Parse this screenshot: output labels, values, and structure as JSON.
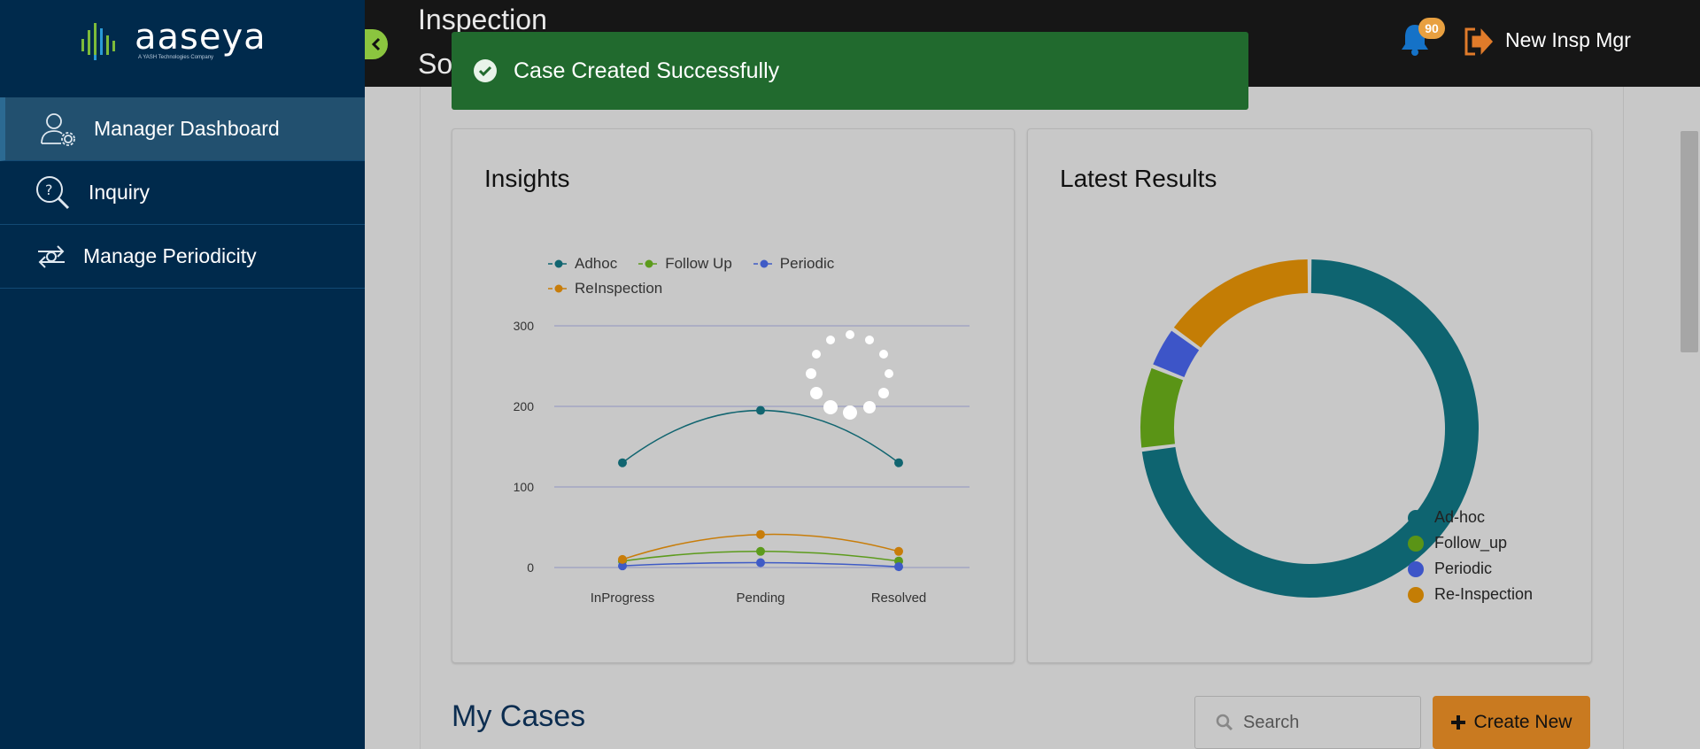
{
  "sidebar": {
    "logo_text": "aaseya",
    "logo_sub": "A YASH Technologies Company",
    "items": [
      {
        "label": "Manager Dashboard",
        "icon": "manager-user-gear-icon",
        "active": true
      },
      {
        "label": "Inquiry",
        "icon": "inquiry-search-icon",
        "active": false
      },
      {
        "label": "Manage Periodicity",
        "icon": "periodicity-refresh-icon",
        "active": false
      }
    ]
  },
  "header": {
    "title_line1": "Inspection",
    "title_line2": "So",
    "notification_count": "90",
    "user_name": "New Insp Mgr"
  },
  "toast": {
    "message": "Case Created Successfully"
  },
  "insights": {
    "title": "Insights"
  },
  "latest_results": {
    "title": "Latest Results"
  },
  "chart_data": [
    {
      "type": "line",
      "categories": [
        "InProgress",
        "Pending",
        "Resolved"
      ],
      "series": [
        {
          "name": "Adhoc",
          "values": [
            130,
            195,
            130
          ],
          "color": "#116570"
        },
        {
          "name": "Follow Up",
          "values": [
            8,
            20,
            8
          ],
          "color": "#5c9b1c"
        },
        {
          "name": "Periodic",
          "values": [
            2,
            6,
            1
          ],
          "color": "#3f5bc6"
        },
        {
          "name": "ReInspection",
          "values": [
            10,
            41,
            20
          ],
          "color": "#c87d0a"
        }
      ],
      "yticks": [
        0,
        100,
        200,
        300
      ],
      "ylim": [
        0,
        300
      ],
      "grid": true,
      "legend": "top"
    },
    {
      "type": "pie",
      "donut": true,
      "labels": [
        "Ad-hoc",
        "Follow_up",
        "Periodic",
        "Re-Inspection"
      ],
      "values": [
        73,
        8,
        4,
        15
      ],
      "colors": [
        "#0e6470",
        "#5a9416",
        "#3d55c8",
        "#c47d05"
      ],
      "legend": "bottom-right"
    }
  ],
  "my_cases": {
    "title": "My Cases",
    "search_placeholder": "Search",
    "create_label": "Create New"
  },
  "colors": {
    "sidebar_bg": "#002a4c",
    "topbar_bg": "#161616",
    "toast_bg": "#216a2e",
    "accent_orange": "#c97a20",
    "toggle_green": "#8bc53f"
  }
}
